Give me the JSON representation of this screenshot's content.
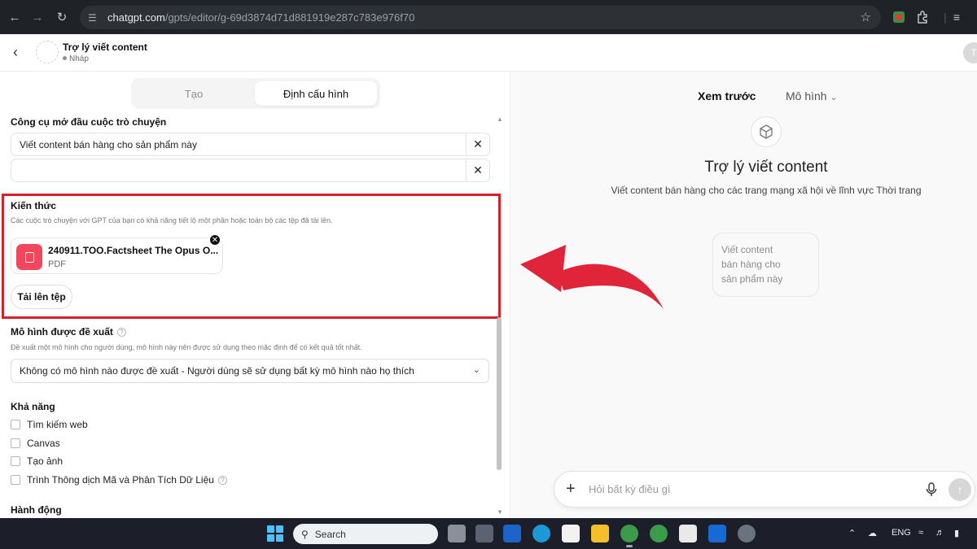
{
  "browser": {
    "url_host": "chatgpt.com",
    "url_path": "/gpts/editor/g-69d3874d71d881919e287c783e976f70"
  },
  "header": {
    "gpt_name": "Trợ lý viết content",
    "gpt_status": "Nháp",
    "user_initial": "T"
  },
  "editor": {
    "tabs": [
      "Tạo",
      "Định cấu hình"
    ],
    "active_tab": "Định cấu hình",
    "conversation_starters": {
      "label": "Công cụ mở đầu cuộc trò chuyện",
      "items": [
        "Viết content bán hàng cho sản phẩm này",
        ""
      ]
    },
    "knowledge": {
      "label": "Kiến thức",
      "description": "Các cuộc trò chuyện với GPT của bạn có khả năng tiết lộ một phần hoặc toàn bộ các tệp đã tải lên.",
      "file_name": "240911.TOO.Factsheet The Opus O...",
      "file_type": "PDF",
      "upload_label": "Tải lên tệp"
    },
    "recommended_model": {
      "label": "Mô hình được đề xuất",
      "description": "Đề xuất một mô hình cho người dùng, mô hình này nên được sử dụng theo mặc định để có kết quả tốt nhất.",
      "selected": "Không có mô hình nào được đề xuất - Người dùng sẽ sử dụng bất kỳ mô hình nào họ thích"
    },
    "capabilities": {
      "label": "Khả năng",
      "items": [
        "Tìm kiếm web",
        "Canvas",
        "Tạo ảnh",
        "Trình Thông dịch Mã và Phân Tích Dữ Liệu"
      ]
    },
    "actions_label": "Hành động"
  },
  "preview": {
    "tab_preview": "Xem trước",
    "tab_model": "Mô hình",
    "title": "Trợ lý viết content",
    "description": "Viết content bán hàng cho các trang mạng xã hội về lĩnh vực Thời trang",
    "starter_lines": [
      "Viết content",
      "bán hàng cho",
      "sản phẩm này"
    ],
    "composer_placeholder": "Hỏi bất kỳ điều gì"
  },
  "taskbar": {
    "search_label": "Search",
    "language": "ENG"
  },
  "colors": {
    "highlight": "#d8202a",
    "arrow": "#e0253a",
    "pdf_icon": "#f2465c"
  }
}
